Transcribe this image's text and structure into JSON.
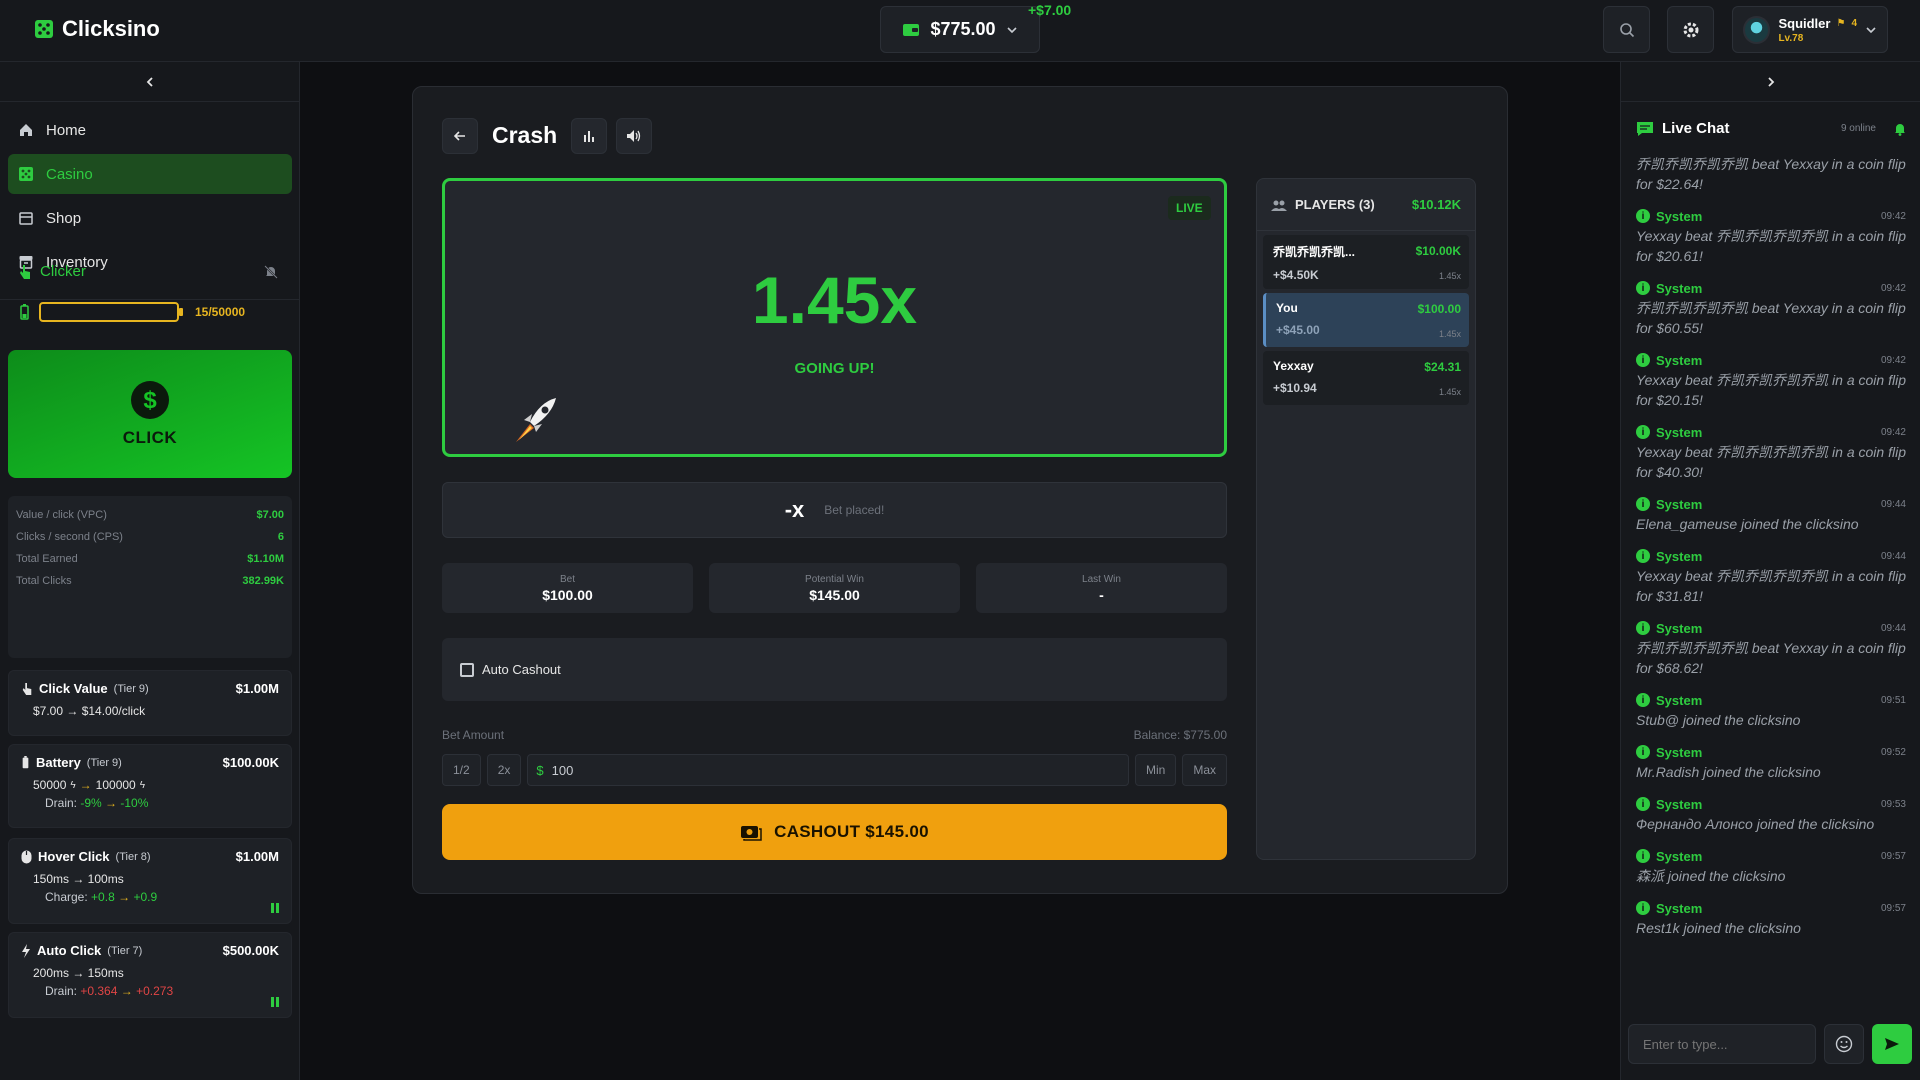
{
  "app": {
    "name": "Clicksino"
  },
  "header": {
    "balance": "$775.00",
    "balance_delta": "+$7.00",
    "user": {
      "name": "Squidler",
      "badge_count": "4",
      "level": "Lv.78"
    }
  },
  "nav": {
    "items": [
      {
        "label": "Home",
        "icon": "home-icon"
      },
      {
        "label": "Casino",
        "icon": "dice-icon",
        "active": true
      },
      {
        "label": "Shop",
        "icon": "store-icon"
      },
      {
        "label": "Inventory",
        "icon": "archive-icon"
      }
    ]
  },
  "clicker": {
    "title": "Clicker",
    "battery_text": "15/50000",
    "battery_fraction": 0.0003,
    "click_label": "CLICK",
    "stats": [
      {
        "label": "Value / click (VPC)",
        "value": "$7.00"
      },
      {
        "label": "Clicks / second (CPS)",
        "value": "6"
      },
      {
        "label": "Total Earned",
        "value": "$1.10M"
      },
      {
        "label": "Total Clicks",
        "value": "382.99K"
      }
    ],
    "upgrades": [
      {
        "name": "Click Value",
        "tier": "(Tier 9)",
        "cost": "$1.00M",
        "line": "$7.00 → $14.00/click"
      },
      {
        "name": "Battery",
        "tier": "(Tier 9)",
        "cost": "$100.00K",
        "from": "50000",
        "to": "100000",
        "drain_label": "Drain:",
        "drain_from": "-9%",
        "drain_to": "-10%"
      },
      {
        "name": "Hover Click",
        "tier": "(Tier 8)",
        "cost": "$1.00M",
        "line": "150ms → 100ms",
        "charge_label": "Charge:",
        "charge_from": "+0.8",
        "charge_to": "+0.9"
      },
      {
        "name": "Auto Click",
        "tier": "(Tier 7)",
        "cost": "$500.00K",
        "line": "200ms → 150ms",
        "drain_label": "Drain:",
        "drain_from": "+0.364",
        "drain_to": "+0.273"
      }
    ]
  },
  "game": {
    "title": "Crash",
    "live": "LIVE",
    "multiplier": "1.45x",
    "status": "GOING UP!",
    "result_x": "-x",
    "result_msg": "Bet placed!",
    "cards": [
      {
        "label": "Bet",
        "value": "$100.00"
      },
      {
        "label": "Potential Win",
        "value": "$145.00"
      },
      {
        "label": "Last Win",
        "value": "-"
      }
    ],
    "auto_cashout": "Auto Cashout",
    "bet_amount_label": "Bet Amount",
    "balance_label": "Balance: $775.00",
    "half": "1/2",
    "double": "2x",
    "currency": "$",
    "amount": "100",
    "min": "Min",
    "max": "Max",
    "cashout": "CASHOUT $145.00"
  },
  "players": {
    "title": "PLAYERS (3)",
    "total": "$10.12K",
    "rows": [
      {
        "name": "乔凯乔凯乔凯...",
        "bet": "$10.00K",
        "profit": "+$4.50K",
        "mult": "1.45x"
      },
      {
        "name": "You",
        "bet": "$100.00",
        "profit": "+$45.00",
        "mult": "1.45x",
        "you": true
      },
      {
        "name": "Yexxay",
        "bet": "$24.31",
        "profit": "+$10.94",
        "mult": "1.45x"
      }
    ]
  },
  "chat": {
    "title": "Live Chat",
    "online": "9 online",
    "partial_top": "乔凯乔凯乔凯乔凯 beat Yexxay in a coin flip for $22.64!",
    "messages": [
      {
        "sender": "System",
        "time": "09:42",
        "text": "Yexxay beat 乔凯乔凯乔凯乔凯 in a coin flip for $20.61!"
      },
      {
        "sender": "System",
        "time": "09:42",
        "text": "乔凯乔凯乔凯乔凯 beat Yexxay in a coin flip for $60.55!"
      },
      {
        "sender": "System",
        "time": "09:42",
        "text": "Yexxay beat 乔凯乔凯乔凯乔凯 in a coin flip for $20.15!"
      },
      {
        "sender": "System",
        "time": "09:42",
        "text": "Yexxay beat 乔凯乔凯乔凯乔凯 in a coin flip for $40.30!"
      },
      {
        "sender": "System",
        "time": "09:44",
        "text": "Elena_gameuse joined the clicksino"
      },
      {
        "sender": "System",
        "time": "09:44",
        "text": "Yexxay beat 乔凯乔凯乔凯乔凯 in a coin flip for $31.81!"
      },
      {
        "sender": "System",
        "time": "09:44",
        "text": "乔凯乔凯乔凯乔凯 beat Yexxay in a coin flip for $68.62!"
      },
      {
        "sender": "System",
        "time": "09:51",
        "text": "Stub@ joined the clicksino"
      },
      {
        "sender": "System",
        "time": "09:52",
        "text": "Mr.Radish joined the clicksino"
      },
      {
        "sender": "System",
        "time": "09:53",
        "text": "Фернандо Алонсо joined the clicksino"
      },
      {
        "sender": "System",
        "time": "09:57",
        "text": "森派 joined the clicksino"
      },
      {
        "sender": "System",
        "time": "09:57",
        "text": "Rest1k joined the clicksino"
      }
    ],
    "placeholder": "Enter to type..."
  },
  "colors": {
    "accent": "#2ecc40",
    "cashout": "#f0a00e",
    "gold": "#e7b520"
  }
}
